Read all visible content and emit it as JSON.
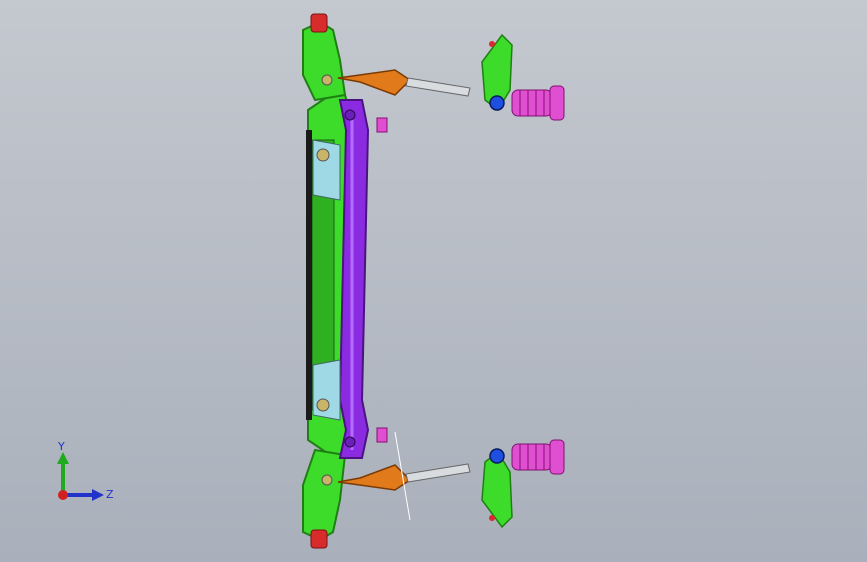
{
  "viewport": {
    "background_top": "#c4c8cf",
    "background_bottom": "#a9b0bb"
  },
  "model": {
    "subject": "front-suspension-subframe-assembly",
    "colors": {
      "subframe": "#3ddc2a",
      "subframe_dark": "#1f7f14",
      "crossmember": "#8a2be2",
      "crossmember_light": "#b46cff",
      "strut_body": "#d9dcdf",
      "boot": "#e04fd1",
      "bushing": "#d82b2b",
      "control_arm": "#e07a1a",
      "knuckle": "#3ddc2a",
      "hub_blue": "#1f4fe0",
      "bracket_cyan": "#9fd9e6"
    }
  },
  "triad": {
    "y_label": "Y",
    "z_label": "Z",
    "colors": {
      "y": "#1faa1f",
      "z": "#2233cc",
      "x": "#d21f1f"
    }
  }
}
